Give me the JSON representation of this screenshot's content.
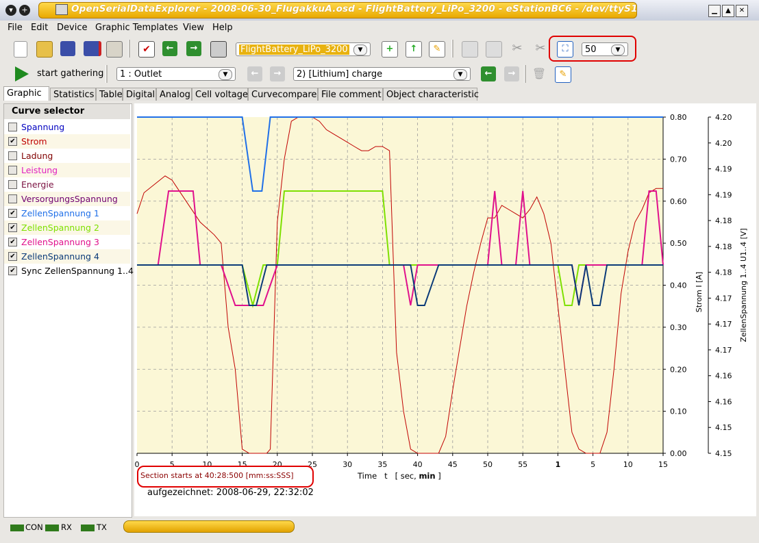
{
  "window": {
    "title": "OpenSerialDataExplorer  -  2008-06-30_FlugakkuA.osd  -  FlightBattery_LiPo_3200  -  eStationBC6  -  /dev/ttyS1"
  },
  "menu": [
    "File",
    "Edit",
    "Device",
    "Graphic Templates",
    "View",
    "Help"
  ],
  "toolbar": {
    "template_combo": "FlightBattery_LiPo_3200",
    "zoom_combo": "50",
    "start_label": "start gathering",
    "outlet_combo": "1 : Outlet",
    "record_combo": "2) [Lithium] charge"
  },
  "tabs": [
    "Graphic",
    "Statistics",
    "Table",
    "Digital",
    "Analog",
    "Cell voltage",
    "Curvecompare",
    "File comment",
    "Object characteristic"
  ],
  "curve_selector": {
    "header": "Curve selector",
    "items": [
      {
        "label": "Spannung",
        "checked": false,
        "color": "#0000c0"
      },
      {
        "label": "Strom",
        "checked": true,
        "color": "#c00000"
      },
      {
        "label": "Ladung",
        "checked": false,
        "color": "#800000"
      },
      {
        "label": "Leistung",
        "checked": false,
        "color": "#e020c0"
      },
      {
        "label": "Energie",
        "checked": false,
        "color": "#7a1040"
      },
      {
        "label": "VersorgungsSpannung",
        "checked": false,
        "color": "#700070"
      },
      {
        "label": "ZellenSpannung 1",
        "checked": true,
        "color": "#1f6fe8"
      },
      {
        "label": "ZellenSpannung 2",
        "checked": true,
        "color": "#7ee000"
      },
      {
        "label": "ZellenSpannung 3",
        "checked": true,
        "color": "#e0108c"
      },
      {
        "label": "ZellenSpannung 4",
        "checked": true,
        "color": "#0a3a78"
      },
      {
        "label": "Sync ZellenSpannung 1..4",
        "checked": true,
        "color": "#000000"
      }
    ]
  },
  "graph": {
    "section_start": "Section starts at  40:28:500 [mm:ss:SSS]",
    "recorded": "aufgezeichnet: 2008-06-29, 22:32:02",
    "x_axis_label": "Time   t   [ sec, ",
    "x_axis_label_bold": "min",
    "x_axis_label_end": " ]",
    "y1_label": "Strom   I  [A]",
    "y2_label": "ZellenSpannung 1..4  U1..4  [V]"
  },
  "chart_data": {
    "type": "line",
    "x_ticks": [
      "0",
      "5",
      "10",
      "15",
      "20",
      "25",
      "30",
      "35",
      "40",
      "45",
      "50",
      "55",
      "1",
      "5",
      "10",
      "15"
    ],
    "x_ticks_bold": [
      false,
      false,
      false,
      false,
      false,
      false,
      false,
      false,
      false,
      false,
      false,
      false,
      true,
      false,
      false,
      false
    ],
    "y1_ticks": [
      "0.80",
      "0.70",
      "0.60",
      "0.50",
      "0.40",
      "0.30",
      "0.20",
      "0.10",
      "0.00"
    ],
    "y1_range": [
      0,
      0.8
    ],
    "y2_ticks": [
      "4.20",
      "4.20",
      "4.19",
      "4.19",
      "4.18",
      "4.18",
      "4.18",
      "4.17",
      "4.17",
      "4.17",
      "4.16",
      "4.16",
      "4.15",
      "4.15"
    ],
    "grid": true,
    "x_domain": [
      0,
      75
    ],
    "series": [
      {
        "name": "Strom",
        "color": "#c00000",
        "axis": "y1",
        "x": [
          0,
          1,
          4,
          5,
          7,
          9,
          11,
          12,
          12.5,
          13,
          14,
          15,
          16,
          17,
          18,
          18.5,
          19,
          20,
          21,
          22,
          23,
          24,
          25,
          26,
          27,
          28,
          29,
          30,
          31,
          32,
          33,
          34,
          35,
          36,
          37,
          38,
          39,
          40,
          41,
          42,
          43,
          44,
          45,
          46,
          47,
          48,
          49,
          50,
          51,
          52,
          53,
          54,
          55,
          56,
          57,
          58,
          59,
          60,
          61,
          62,
          63,
          64,
          65,
          66,
          67,
          68,
          69,
          70,
          71,
          72,
          73,
          74,
          75
        ],
        "y": [
          0.57,
          0.62,
          0.66,
          0.65,
          0.6,
          0.55,
          0.52,
          0.5,
          0.4,
          0.3,
          0.2,
          0.01,
          0.0,
          0.0,
          0.0,
          0.0,
          0.01,
          0.55,
          0.7,
          0.79,
          0.8,
          0.8,
          0.8,
          0.79,
          0.77,
          0.76,
          0.75,
          0.74,
          0.73,
          0.72,
          0.72,
          0.73,
          0.73,
          0.72,
          0.24,
          0.1,
          0.01,
          0.0,
          0.0,
          0.0,
          0.0,
          0.04,
          0.15,
          0.25,
          0.35,
          0.43,
          0.5,
          0.56,
          0.56,
          0.59,
          0.58,
          0.57,
          0.56,
          0.58,
          0.61,
          0.57,
          0.5,
          0.35,
          0.2,
          0.05,
          0.01,
          0.0,
          0.0,
          0.0,
          0.05,
          0.2,
          0.38,
          0.48,
          0.55,
          0.58,
          0.62,
          0.63,
          0.63
        ]
      },
      {
        "name": "ZellenSpannung 1",
        "color": "#1f6fe8",
        "axis": "y2",
        "x": [
          0,
          15,
          16.5,
          17.8,
          19,
          75
        ],
        "y": [
          4.2,
          4.2,
          4.189,
          4.189,
          4.2,
          4.2
        ]
      },
      {
        "name": "ZellenSpannung 2",
        "color": "#7ee000",
        "axis": "y2",
        "x": [
          0,
          15,
          16.5,
          18,
          20,
          21,
          34,
          35,
          36,
          60,
          61,
          62,
          63,
          75
        ],
        "y": [
          4.178,
          4.178,
          4.172,
          4.178,
          4.178,
          4.189,
          4.189,
          4.189,
          4.178,
          4.178,
          4.172,
          4.172,
          4.178,
          4.178
        ]
      },
      {
        "name": "ZellenSpannung 3",
        "color": "#e0108c",
        "axis": "y2",
        "x": [
          0,
          3,
          4.5,
          7,
          8,
          9,
          12,
          14,
          16,
          18,
          20,
          36,
          38,
          39,
          40,
          42,
          50,
          51,
          52,
          53,
          54,
          55,
          56,
          57,
          58,
          59,
          60,
          61,
          62,
          63,
          64,
          65,
          66,
          67,
          70,
          72,
          73,
          74,
          75
        ],
        "y": [
          4.178,
          4.178,
          4.189,
          4.189,
          4.189,
          4.178,
          4.178,
          4.172,
          4.172,
          4.172,
          4.178,
          4.178,
          4.178,
          4.172,
          4.178,
          4.178,
          4.178,
          4.189,
          4.178,
          4.178,
          4.178,
          4.189,
          4.178,
          4.178,
          4.178,
          4.178,
          4.178,
          4.178,
          4.178,
          4.172,
          4.178,
          4.178,
          4.178,
          4.178,
          4.178,
          4.178,
          4.189,
          4.189,
          4.178
        ]
      },
      {
        "name": "ZellenSpannung 4",
        "color": "#0a3a78",
        "axis": "y2",
        "x": [
          0,
          12,
          14,
          15,
          16,
          17,
          18.5,
          19.5,
          20,
          39,
          40,
          41,
          43,
          62,
          63,
          64,
          65,
          66,
          67,
          68,
          75
        ],
        "y": [
          4.178,
          4.178,
          4.178,
          4.178,
          4.172,
          4.172,
          4.178,
          4.178,
          4.178,
          4.178,
          4.172,
          4.172,
          4.178,
          4.178,
          4.172,
          4.178,
          4.172,
          4.172,
          4.178,
          4.178,
          4.178
        ]
      }
    ]
  }
}
